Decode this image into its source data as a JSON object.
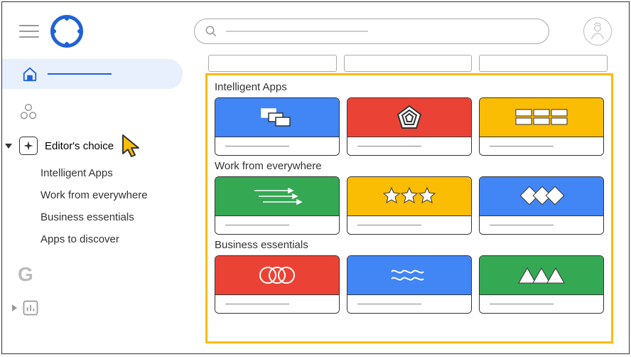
{
  "sidebar": {
    "editor_label": "Editor's choice",
    "items": [
      {
        "label": "Intelligent Apps"
      },
      {
        "label": "Work from everywhere"
      },
      {
        "label": "Business essentials"
      },
      {
        "label": "Apps to discover"
      }
    ]
  },
  "sections": [
    {
      "title": "Intelligent Apps"
    },
    {
      "title": "Work from everywhere"
    },
    {
      "title": "Business essentials"
    }
  ]
}
